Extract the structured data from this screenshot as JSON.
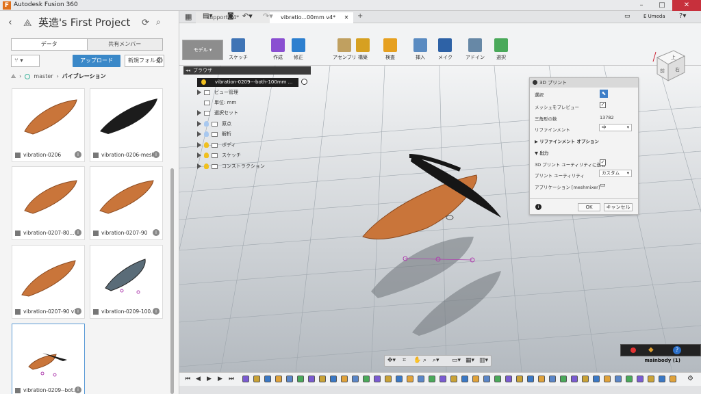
{
  "window": {
    "title": "Autodesk Fusion 360"
  },
  "user": {
    "name": "E Umeda",
    "help": "?"
  },
  "panel": {
    "title": "英造's First Project",
    "tabs": [
      {
        "label": "データ"
      },
      {
        "label": "共有メンバー"
      }
    ],
    "upload_label": "アップロード",
    "new_folder_label": "新規フォルダ",
    "breadcrumb": {
      "branch": "master",
      "folder": "バイブレーション"
    },
    "files": [
      {
        "name": "vibration-0206",
        "color": "#c9753a"
      },
      {
        "name": "vibration-0206-mesh",
        "color": "#1c1c1c"
      },
      {
        "name": "vibration-0207-80...",
        "color": "#c9753a"
      },
      {
        "name": "vibration-0207-90",
        "color": "#c9753a"
      },
      {
        "name": "vibration-0207-90 v1",
        "color": "#c9753a"
      },
      {
        "name": "vibration-0209-100...",
        "color": "#5a6c78"
      },
      {
        "name": "vibration-0209--bot...",
        "color": "#c9753a"
      }
    ]
  },
  "doc_tabs": [
    {
      "label": "support v4*"
    },
    {
      "label": "vibratio...00mm v4*"
    }
  ],
  "toolbar": {
    "workspace": "モデル",
    "groups": [
      {
        "label": "スケッチ",
        "color": "#3f74b5"
      },
      {
        "label": "作成",
        "color": "#8a4fd1"
      },
      {
        "label": "修正",
        "color": "#2d7fcf"
      },
      {
        "label": "アセンブリ",
        "color": "#c0a060"
      },
      {
        "label": "構築",
        "color": "#d6a021"
      },
      {
        "label": "検査",
        "color": "#e6a020"
      },
      {
        "label": "挿入",
        "color": "#5a8bc1"
      },
      {
        "label": "メイク",
        "color": "#2e62a6"
      },
      {
        "label": "アドイン",
        "color": "#6788a6"
      },
      {
        "label": "選択",
        "color": "#4aa95a"
      }
    ]
  },
  "browser": {
    "header": "ブラウザ",
    "root": "vibration-0209---both-100mm ...",
    "items": [
      {
        "label": "ビュー管理"
      },
      {
        "label": "単位: mm"
      },
      {
        "label": "選択セット"
      },
      {
        "label": "原点"
      },
      {
        "label": "解析"
      },
      {
        "label": "ボディ"
      },
      {
        "label": "スケッチ"
      },
      {
        "label": "コンストラクション"
      }
    ]
  },
  "print_dialog": {
    "title": "3D プリント",
    "select_label": "選択",
    "preview_label": "メッシュをプレビュー",
    "triangles_label": "三角形の数",
    "triangles_value": "13782",
    "refinement_label": "リファインメント",
    "refinement_value": "中",
    "refinement_options_label": "リファインメント オプション",
    "output_label": "出力",
    "send_label": "3D プリント ユーティリティに送信",
    "utility_label": "プリント ユーティリティ",
    "utility_value": "カスタム",
    "app_label": "アプリケーション [meshmixer]",
    "ok_label": "OK",
    "cancel_label": "キャンセル"
  },
  "viewcube": {
    "top": "上",
    "front": "前",
    "right": "右"
  },
  "status": {
    "mainbody": "mainbody (1)"
  }
}
